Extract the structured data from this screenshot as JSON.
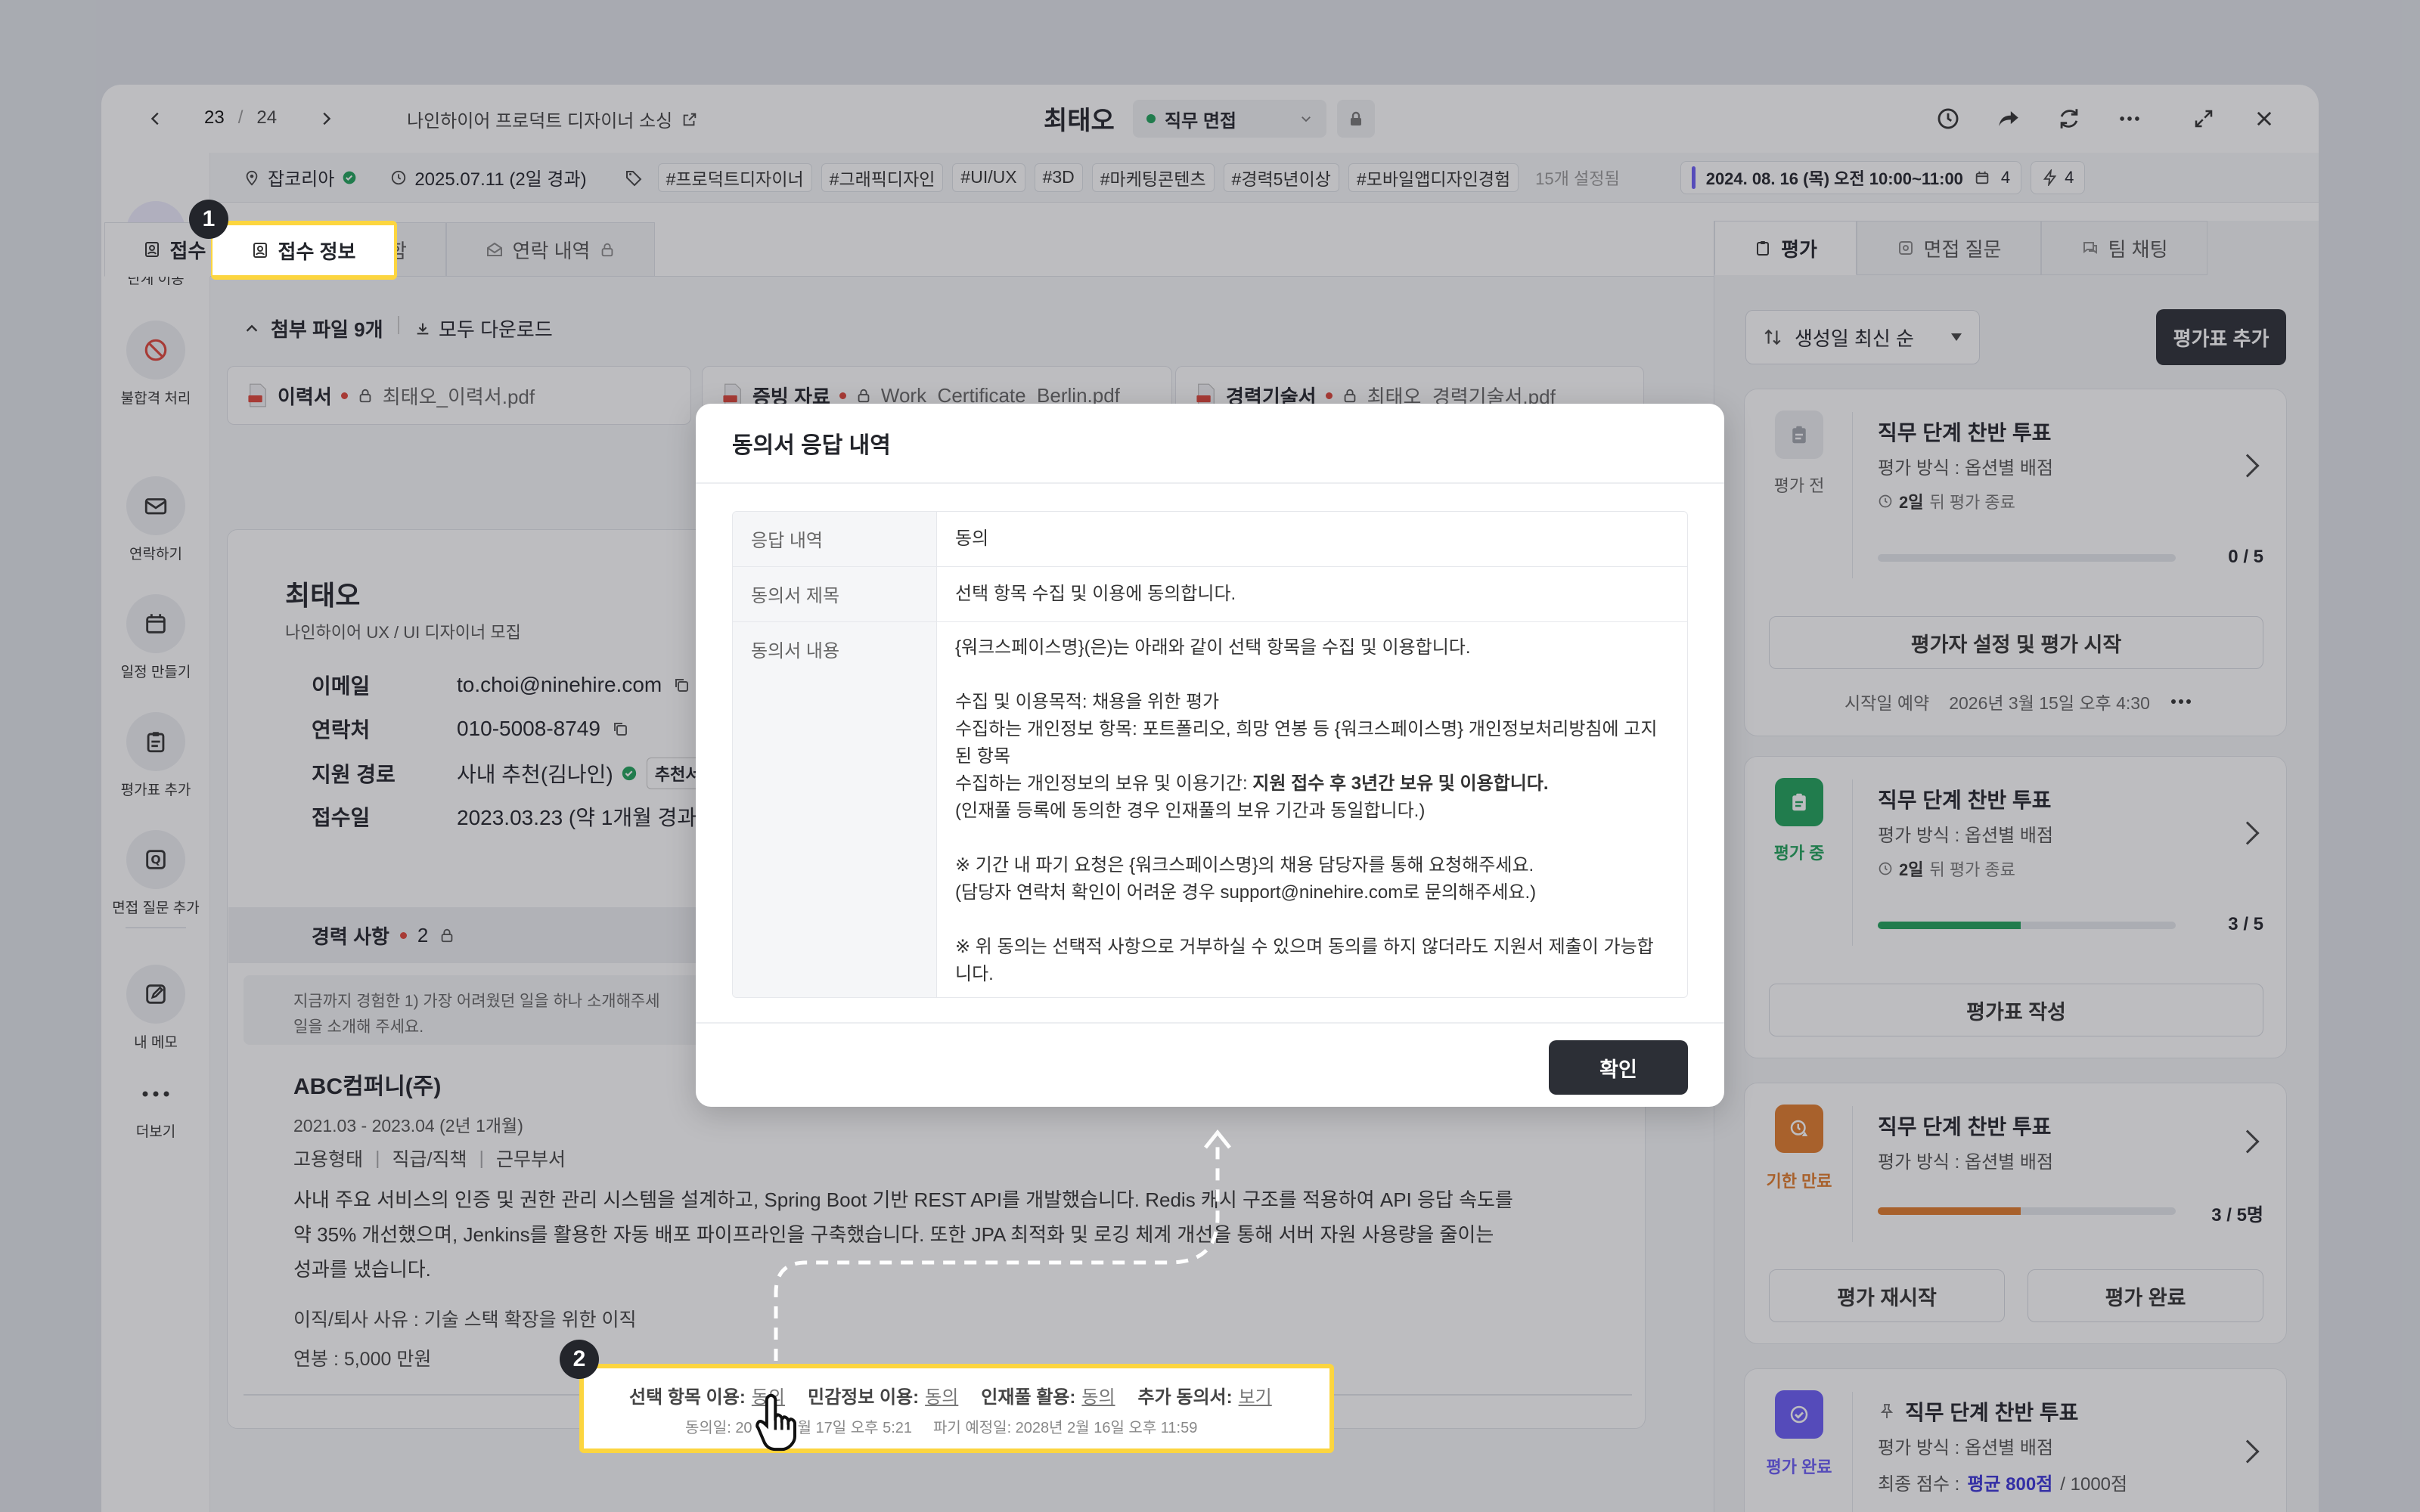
{
  "topbar": {
    "page_current": "23",
    "page_sep": "/",
    "page_total": "24",
    "job_title": "나인하이어 프로덕트 디자이너 소싱",
    "candidate_name": "최태오",
    "stage_label": "직무 면접"
  },
  "infobar": {
    "source": "잡코리아",
    "date": "2025.07.11 (2일 경과)",
    "tags": [
      "#프로덕트디자이너",
      "#그래픽디자인",
      "#UI/UX",
      "#3D",
      "#마케팅콘텐츠",
      "#경력5년이상",
      "#모바일앱디자인경험"
    ],
    "tags_more": "15개 설정됨",
    "schedule": "2024. 08. 16 (목) 오전 10:00~11:00",
    "schedule_count": "4",
    "action_count": "4"
  },
  "rail": {
    "items": [
      {
        "label": "단계 이동",
        "icon": "arrow-right-icon"
      },
      {
        "label": "불합격 처리",
        "icon": "block-icon"
      },
      {
        "label": "연락하기",
        "icon": "mail-icon"
      },
      {
        "label": "일정 만들기",
        "icon": "calendar-icon"
      },
      {
        "label": "평가표 추가",
        "icon": "clipboard-icon"
      },
      {
        "label": "면접 질문 추가",
        "icon": "question-icon"
      },
      {
        "label": "내 메모",
        "icon": "edit-icon"
      },
      {
        "label": "더보기",
        "icon": "more-icon"
      }
    ]
  },
  "tabs": {
    "reception": "접수 정보",
    "materials": "자료함",
    "contact": "연락 내역"
  },
  "attachments": {
    "header": "첨부 파일 9개",
    "download_all": "모두 다운로드",
    "files": [
      {
        "type": "이력서",
        "name": "최태오_이력서.pdf"
      },
      {
        "type": "증빙 자료",
        "name": "Work_Certificate_Berlin.pdf"
      },
      {
        "type": "경력기술서",
        "name": "최태오_경력기술서.pdf"
      }
    ]
  },
  "profile": {
    "name": "최태오",
    "posting": "나인하이어 UX / UI 디자이너 모집",
    "fields": [
      {
        "k": "이메일",
        "v": "to.choi@ninehire.com"
      },
      {
        "k": "연락처",
        "v": "010-5008-8749"
      },
      {
        "k": "지원 경로",
        "v": "사내 추천(김나인)"
      },
      {
        "k": "접수일",
        "v": "2023.03.23 (약 1개월 경과)"
      }
    ],
    "referral_badge": "추천서"
  },
  "career": {
    "title": "경력 사항",
    "count": "2",
    "prompt_line1": "지금까지 경험한 1) 가장 어려웠던 일을 하나 소개해주세",
    "prompt_line2": "일을 소개해 주세요.",
    "company": "ABC컴퍼니(주)",
    "period": "2021.03 - 2023.04 (2년 1개월)",
    "meta": [
      "고용형태",
      "직급/직책",
      "근무부서"
    ],
    "desc_line1": "사내 주요 서비스의 인증 및 권한 관리 시스템을 설계하고, Spring Boot 기반 REST API를 개발했습니다. Redis 캐시 구조를 적용하여 API 응답 속도를",
    "desc_line2": "약 35% 개선했으며, Jenkins를 활용한 자동 배포 파이프라인을 구축했습니다. 또한 JPA 최적화 및 로깅 체계 개선을 통해 서버 자원 사용량을 줄이는",
    "desc_line3": "성과를 냈습니다.",
    "reason": "이직/퇴사 사유 : 기술 스택 확장을 위한 이직",
    "salary": "연봉 : 5,000 만원"
  },
  "consent_bar": {
    "items": [
      {
        "k": "선택 항목 이용:",
        "v": "동의"
      },
      {
        "k": "민감정보 이용:",
        "v": "동의"
      },
      {
        "k": "인재풀 활용:",
        "v": "동의"
      },
      {
        "k": "추가 동의서:",
        "v": "보기"
      }
    ],
    "date_a": "동의일: 20",
    "date_b": "월 17일 오후 5:21",
    "expire": "파기 예정일: 2028년 2월 16일 오후 11:59"
  },
  "right_panel": {
    "tabs": [
      "평가",
      "면접 질문",
      "팀 채팅"
    ],
    "sort": "생성일 최신 순",
    "add_button": "평가표 추가",
    "cards": [
      {
        "state": "평가 전",
        "title": "직무 단계 찬반 투표",
        "method": "평가 방식 : 옵션별 배점",
        "remain_num": "2일",
        "remain_text": "뒤 평가 종료",
        "score": "0 / 5",
        "progress": 0,
        "button": "평가자 설정 및 평가 시작",
        "footer_label": "시작일 예약",
        "footer_date": "2026년 3월 15일 오후 4:30"
      },
      {
        "state": "평가 중",
        "title": "직무 단계 찬반 투표",
        "method": "평가 방식 : 옵션별 배점",
        "remain_num": "2일",
        "remain_text": "뒤 평가 종료",
        "score": "3 / 5",
        "progress": 0.48,
        "button": "평가표 작성"
      },
      {
        "state": "기한 만료",
        "title": "직무 단계 찬반 투표",
        "method": "평가 방식 : 옵션별 배점",
        "score": "3 / 5명",
        "progress": 0.48,
        "button_a": "평가 재시작",
        "button_b": "평가 완료"
      },
      {
        "state": "평가 완료",
        "title": "직무 단계 찬반 투표",
        "method": "평가 방식 : 옵션별 배점",
        "score_label": "최종 점수 :",
        "score_avg": "평균 800점",
        "score_total": "/ 1000점"
      }
    ]
  },
  "modal": {
    "title": "동의서 응답 내역",
    "rows": [
      {
        "k": "응답 내역",
        "v": "동의"
      },
      {
        "k": "동의서 제목",
        "v": "선택 항목 수집 및 이용에 동의합니다."
      }
    ],
    "content_key": "동의서 내용",
    "content": {
      "p1": "{워크스페이스명}(은)는 아래와 같이 선택 항목을 수집 및 이용합니다.",
      "p2": "수집 및 이용목적: 채용을 위한 평가",
      "p3a": "수집하는 개인정보 항목: 포트폴리오, 희망 연봉 등 {워크스페이스명} 개인정보처리방침에 고지",
      "p3b": "된 항목",
      "p4_prefix": "수집하는 개인정보의 보유 및 이용기간: ",
      "p4_bold": "지원 접수 후 3년간 보유 및 이용합니다.",
      "p5": "(인재풀 등록에 동의한 경우 인재풀의 보유 기간과 동일합니다.)",
      "p6": "※ 기간 내 파기 요청은 {워크스페이스명}의 채용 담당자를 통해 요청해주세요.",
      "p7": "(담당자 연락처 확인이 어려운 경우 support@ninehire.com로 문의해주세요.)",
      "p8a": "※ 위 동의는 선택적 사항으로 거부하실 수 있으며 동의를 하지 않더라도 지원서 제출이 가능합",
      "p8b": "니다."
    },
    "confirm": "확인"
  },
  "callouts": {
    "one": "1",
    "two": "2"
  },
  "colors": {
    "accent": "#6b5cf6",
    "highlight": "#fcd53f",
    "green": "#20a35b",
    "orange": "#e17c2c",
    "dark": "#2c2f36"
  }
}
